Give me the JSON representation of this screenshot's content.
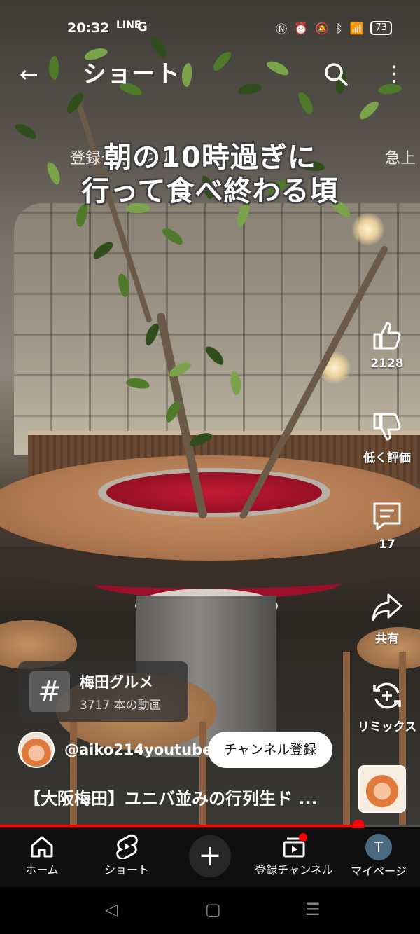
{
  "status_bar": {
    "time": "20:32",
    "app_icons": [
      "LINE",
      "G"
    ],
    "battery": "73"
  },
  "header": {
    "title": "ショート"
  },
  "video": {
    "subtitle_row_left": "登録チャンネル",
    "subtitle_row_right": "急上",
    "caption_line1": "朝の10時過ぎに",
    "caption_line2": "行って食べ終わる頃"
  },
  "actions": {
    "likes": "2128",
    "dislike_label": "低く評価",
    "comments": "17",
    "share_label": "共有",
    "remix_label": "リミックス"
  },
  "hashtag": {
    "symbol": "#",
    "title": "梅田グルメ",
    "count_text": "3717 本の動画"
  },
  "channel": {
    "handle": "@aiko214youtube",
    "subscribe_label": "チャンネル登録"
  },
  "video_title": "【大阪梅田】ユニバ並みの行列生ド ...",
  "progress": {
    "fraction": 0.853
  },
  "bottom_nav": [
    {
      "label": "ホーム",
      "icon": "home-icon"
    },
    {
      "label": "ショート",
      "icon": "shorts-icon"
    },
    {
      "label": "",
      "icon": "plus-icon"
    },
    {
      "label": "登録チャンネル",
      "icon": "subscriptions-icon"
    },
    {
      "label": "マイページ",
      "icon": "avatar-icon",
      "avatar_letter": "T"
    }
  ],
  "colors": {
    "accent": "#ff0000",
    "nav_bg": "#0f0f0f"
  }
}
